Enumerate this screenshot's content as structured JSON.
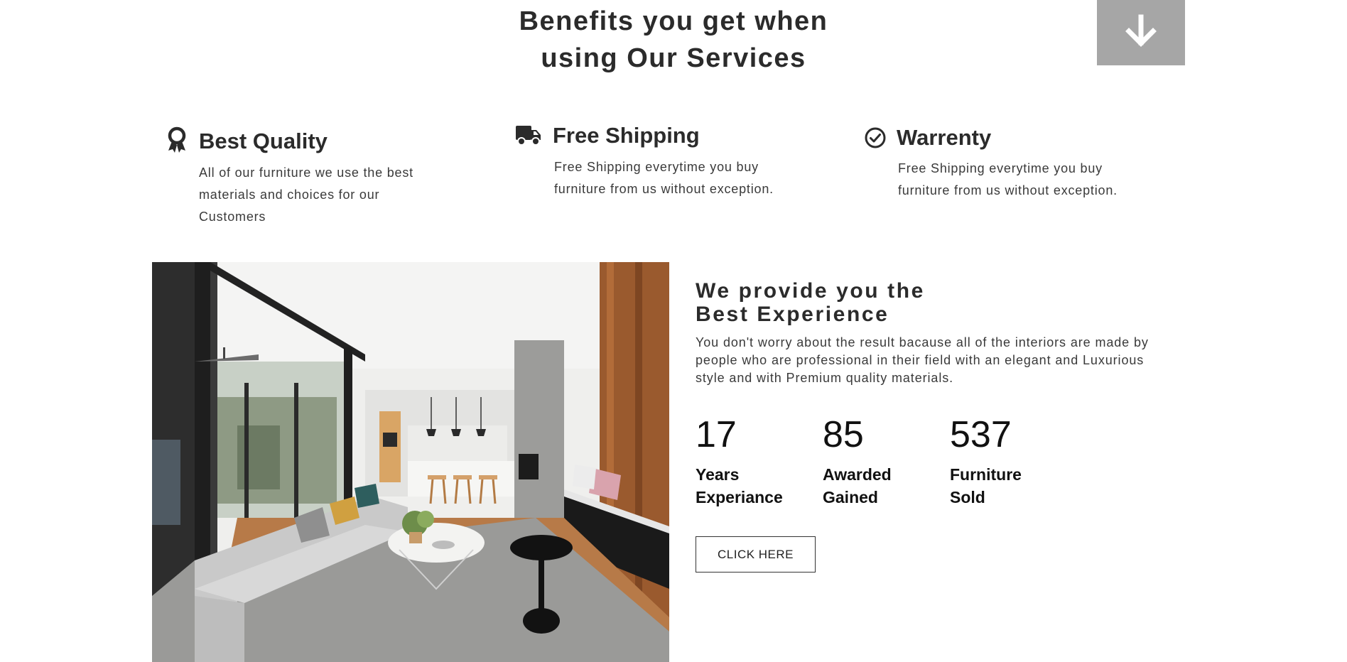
{
  "benefits": {
    "title_line1": "Benefits you get when",
    "title_line2": "using Our Services"
  },
  "scroll_button": {
    "icon": "arrow-down-icon"
  },
  "features": [
    {
      "icon": "award-ribbon-icon",
      "title": "Best Quality",
      "text": "All of our furniture we use the best materials and choices for our Customers"
    },
    {
      "icon": "truck-icon",
      "title": "Free Shipping",
      "text": "Free Shipping everytime you buy furniture from us without exception."
    },
    {
      "icon": "check-circle-icon",
      "title": "Warrenty",
      "text": "Free Shipping everytime you buy furniture from us without exception."
    }
  ],
  "experience": {
    "title_line1": "We provide you the",
    "title_line2": "Best Experience",
    "description": "You don't worry about the result bacause all of the interiors are made by people who are professional in their field with an elegant and Luxurious style and with Premium quality materials.",
    "stats": [
      {
        "value": "17",
        "label_line1": "Years",
        "label_line2": "Experiance"
      },
      {
        "value": "85",
        "label_line1": "Awarded",
        "label_line2": "Gained"
      },
      {
        "value": "537",
        "label_line1": "Furniture",
        "label_line2": "Sold"
      }
    ],
    "cta_label": "CLICK HERE"
  },
  "colors": {
    "heading": "#2b2b2b",
    "body_text": "#3a3a3a",
    "scroll_button_bg": "#a6a6a6",
    "stat_text": "#111111",
    "wood_accent": "#9a5a2e"
  }
}
